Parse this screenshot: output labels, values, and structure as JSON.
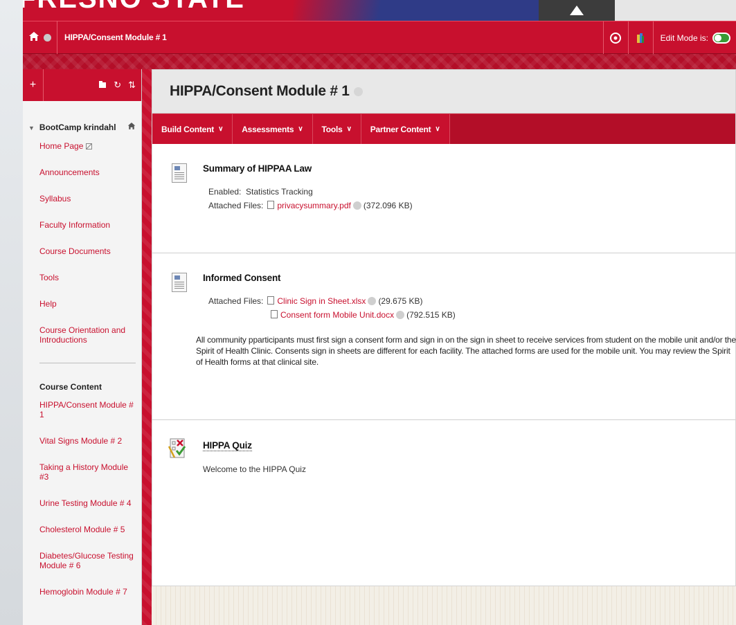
{
  "banner": {
    "letters": "FRESNO STATE"
  },
  "topbar": {
    "breadcrumb": "HIPPA/Consent Module # 1",
    "edit_mode_label": "Edit Mode is:"
  },
  "sidebar": {
    "course_name": "BootCamp krindahl",
    "nav_items": [
      "Home Page",
      "Announcements",
      "Syllabus",
      "Faculty Information",
      "Course Documents",
      "Tools",
      "Help",
      "Course Orientation and Introductions"
    ],
    "section_heading": "Course Content",
    "content_items": [
      "HIPPA/Consent Module # 1",
      "Vital Signs Module # 2",
      "Taking a History Module #3",
      "Urine Testing Module # 4",
      "Cholesterol Module # 5",
      "Diabetes/Glucose Testing Module # 6",
      "Hemoglobin Module # 7"
    ]
  },
  "page": {
    "title": "HIPPA/Consent Module # 1",
    "actions": [
      "Build Content",
      "Assessments",
      "Tools",
      "Partner Content"
    ],
    "items": [
      {
        "title": "Summary of HIPPAA Law",
        "enabled_label": "Enabled:",
        "enabled_value": "Statistics Tracking",
        "files_label": "Attached Files:",
        "files": [
          {
            "name": "privacysummary.pdf",
            "size": "(372.096 KB)"
          }
        ]
      },
      {
        "title": "Informed Consent",
        "files_label": "Attached Files:",
        "files": [
          {
            "name": "Clinic Sign in Sheet.xlsx",
            "size": "(29.675 KB)"
          },
          {
            "name": "Consent form Mobile Unit.docx",
            "size": "(792.515 KB)"
          }
        ],
        "description": "All community pparticipants must first sign a consent form and sign in on the sign in sheet to receive services from student on the mobile unit and/or the Spirit of Health Clinic. Consents sign in sheets are different for each facility.  The attached forms are used for the mobile unit.  You may review the Spirit of Health forms at that clinical site."
      },
      {
        "title": "HIPPA Quiz",
        "description": "Welcome to the HIPPA  Quiz"
      }
    ]
  },
  "colors": {
    "brand_red": "#c8102e",
    "dark_red": "#b30e28",
    "toggle_green": "#3a9b35"
  },
  "icons": [
    "home-icon",
    "chevron-circle-icon",
    "accessibility-icon",
    "color-theme-icon",
    "add-icon",
    "folder-icon",
    "refresh-icon",
    "sort-icon",
    "document-icon",
    "quiz-icon",
    "file-icon"
  ]
}
